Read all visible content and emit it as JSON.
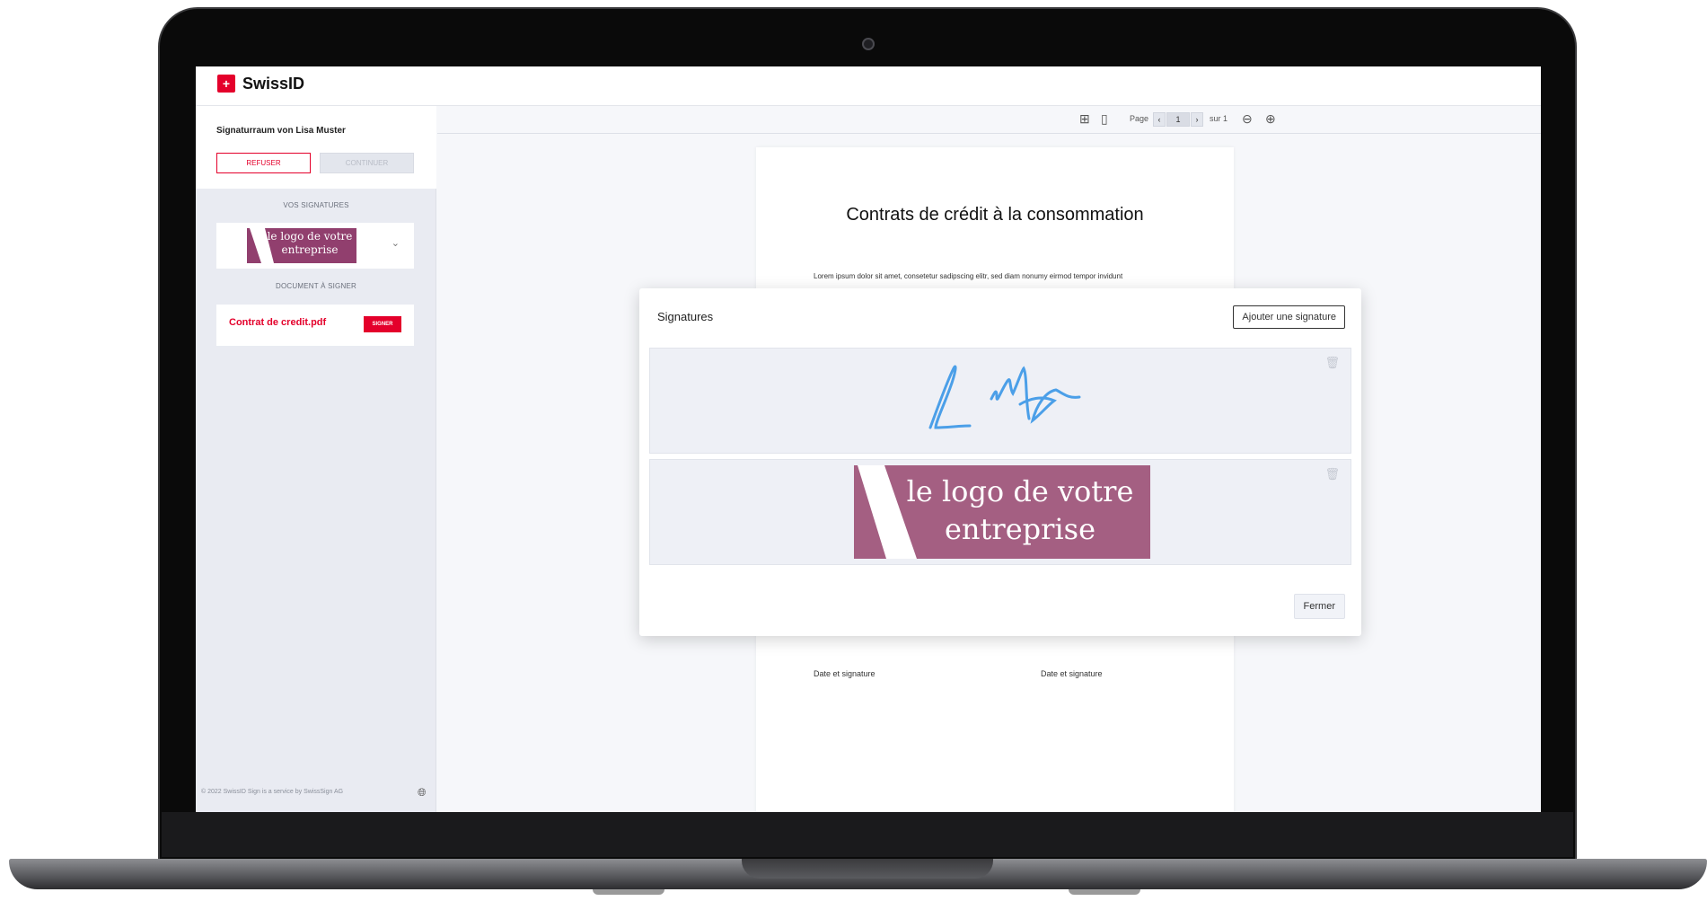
{
  "app": {
    "brand": "SwissID",
    "brand_mark": "+"
  },
  "sidebar": {
    "room_title": "Signaturraum von Lisa Muster",
    "refuse_label": "REFUSER",
    "continue_label": "CONTINUER",
    "signatures_heading": "VOS SIGNATURES",
    "signature_logo_text": "le logo de votre entreprise",
    "document_heading": "DOCUMENT À SIGNER",
    "document_name": "Contrat de credit.pdf",
    "sign_label": "SIGNER",
    "footer": "© 2022 SwissID Sign is a service by SwissSign AG"
  },
  "viewer": {
    "page_label": "Page",
    "current_page": "1",
    "of_label": "sur 1"
  },
  "document": {
    "title": "Contrats de crédit à la consommation",
    "body": "Lorem ipsum dolor sit amet, consetetur sadipscing elitr, sed diam nonumy eirmod tempor invidunt",
    "date_signature_left": "Date et signature",
    "date_signature_right": "Date et signature"
  },
  "modal": {
    "title": "Signatures",
    "add_button": "Ajouter une signature",
    "logo_signature_text": "le logo de votre entreprise",
    "close_button": "Fermer"
  },
  "colors": {
    "brand_red": "#e4002b",
    "logo_purple": "#a45f82",
    "signature_blue": "#4b9fe8"
  }
}
